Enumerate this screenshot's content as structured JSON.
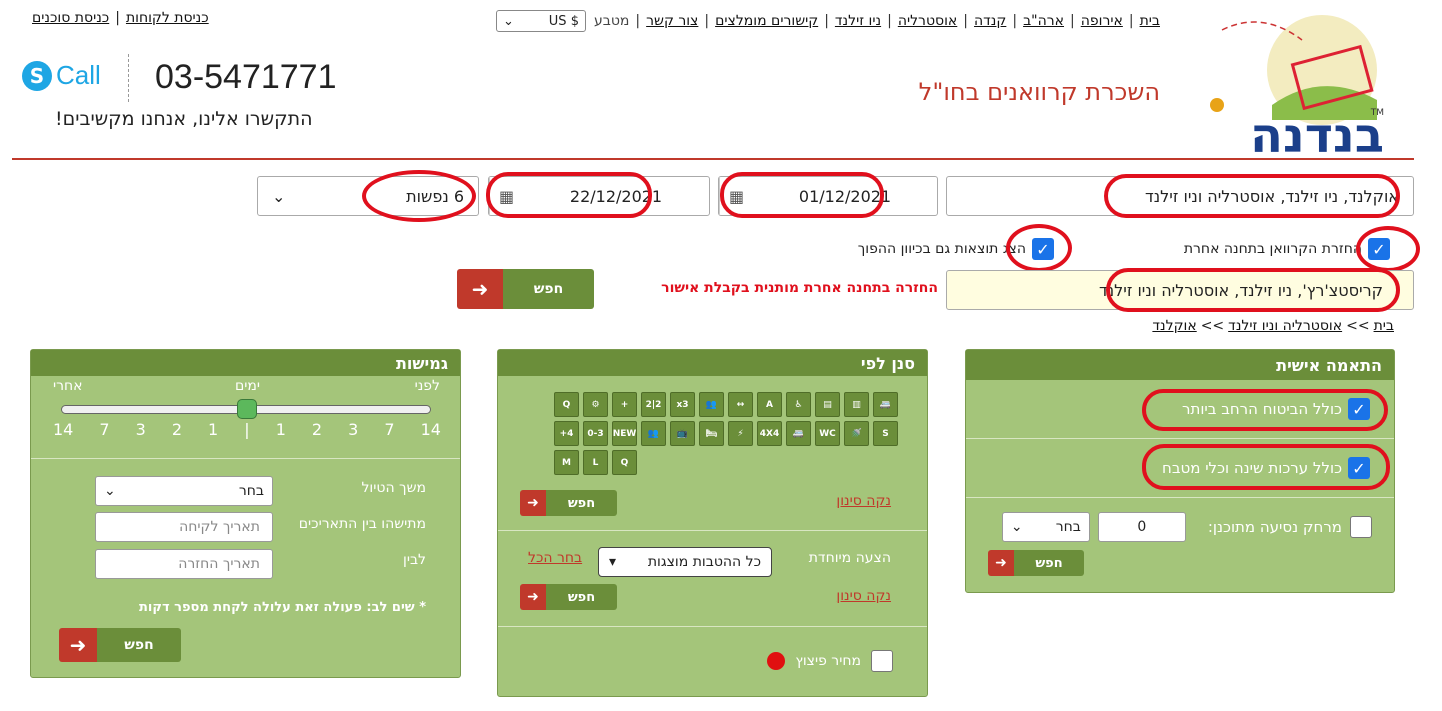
{
  "nav": {
    "items": [
      "בית",
      "אירופה",
      "ארה\"ב",
      "קנדה",
      "אוסטרליה",
      "ניו זילנד",
      "קישורים מומלצים",
      "צור קשר"
    ],
    "currency_label": "מטבע",
    "currency_value": "US $"
  },
  "agents": {
    "agents_link": "כניסת סוכנים",
    "customers_link": "כניסת לקוחות"
  },
  "header": {
    "subtitle": "השכרת קרוואנים בחו\"ל",
    "phone": "03-5471771",
    "skype_label": "Call",
    "skype_letter": "S",
    "contact_text": "התקשרו אלינו, אנחנו מקשיבים!",
    "logo_text": "בנדנה",
    "logo_tm": "TM"
  },
  "search": {
    "pickup_location": "אוקלנד, ניו זילנד, אוסטרליה וניו זילנד",
    "pickup_date": "01/12/2021",
    "return_date": "22/12/2021",
    "passengers": "6 נפשות",
    "return_other_station_label": "החזרת הקרוואן בתחנה אחרת",
    "reverse_results_label": "הצג תוצאות גם בכיוון ההפוך",
    "return_location": "קריסטצ'רץ', ניו זילנד, אוסטרליה וניו זילנד",
    "return_note": "החזרה בתחנה אחרת מותנית בקבלת אישור",
    "search_button": "חפש"
  },
  "breadcrumb": {
    "home": "בית",
    "region": "אוסטרליה וניו זילנד",
    "city": "אוקלנד",
    "sep": ">>"
  },
  "personal_panel": {
    "title": "התאמה אישית",
    "option1": "כולל הביטוח הרחב ביותר",
    "option2": "כולל ערכות שינה וכלי מטבח",
    "distance_label": "מרחק נסיעה מתוכנן:",
    "distance_value": "0",
    "distance_select": "בחר",
    "search_button": "חפש"
  },
  "filter_panel": {
    "title": "סנן לפי",
    "clear_link": "נקה סינון",
    "search_button": "חפש",
    "special_offer_label": "הצעה מיוחדת",
    "special_offer_value": "כל ההטבות מוצגות",
    "select_all": "בחר הכל",
    "clear_link2": "נקה סינון",
    "search_button2": "חפש",
    "compensation_label": "מחיר פיצוץ",
    "icons": [
      "Q",
      "⚙",
      "+",
      "2|2",
      "x3",
      "👥",
      "↔",
      "A",
      "♿",
      "▤",
      "▥",
      "🚐",
      "+4",
      "0-3",
      "NEW",
      "👥",
      "📺",
      "🛏",
      "⚡",
      "4X4",
      "🚐",
      "WC",
      "🚿",
      "S",
      "M",
      "L",
      "Q"
    ]
  },
  "flex_panel": {
    "title": "גמישות",
    "before": "לפני",
    "days": "ימים",
    "after": "אחרי",
    "scale": [
      "14",
      "7",
      "3",
      "2",
      "1",
      "|",
      "1",
      "2",
      "3",
      "7",
      "14"
    ],
    "slider_level": 0.5,
    "trip_length_label": "משך הטיול",
    "trip_length_value": "בחר",
    "between_dates_label": "מתישהו בין התאריכים",
    "pickup_date_placeholder": "תאריך לקיחה",
    "and_label": "לבין",
    "return_date_placeholder": "תאריך החזרה",
    "note": "* שים לב: פעולה זאת עלולה לקחת מספר דקות",
    "search_button": "חפש"
  }
}
